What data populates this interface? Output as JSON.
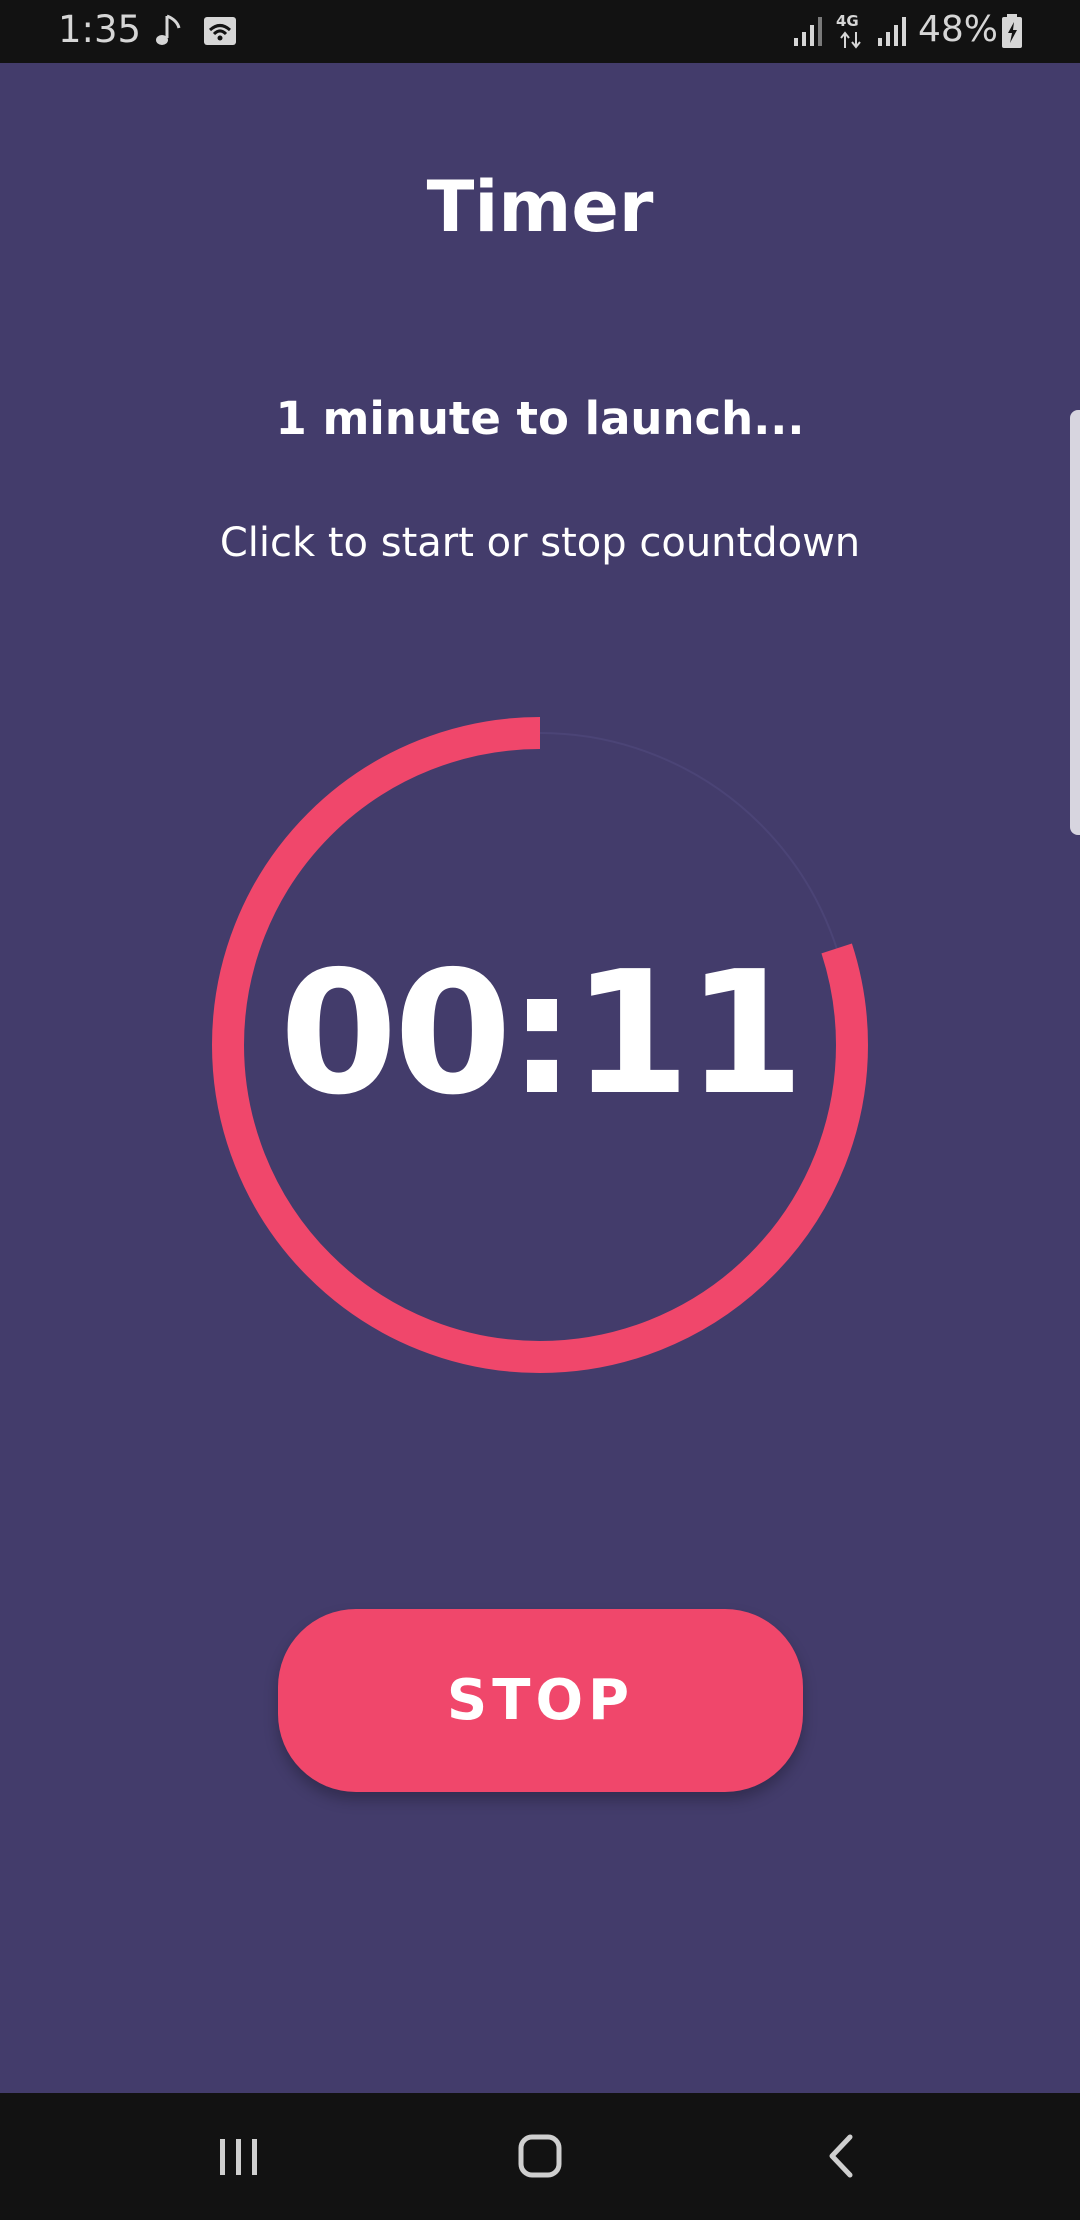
{
  "status_bar": {
    "time": "1:35",
    "battery_percent": "48%",
    "network_label": "4G",
    "icons": [
      "music-note-icon",
      "wifi-icon",
      "signal-icon",
      "signal-icon",
      "battery-charging-icon"
    ]
  },
  "page": {
    "title": "Timer",
    "subtitle": "1 minute to launch...",
    "hint": "Click to start or stop countdown"
  },
  "timer": {
    "readout": "00:11",
    "remaining_fraction": 0.8,
    "progress_color": "#f0476b",
    "track_color": "#4b4476"
  },
  "actions": {
    "stop_label": "STOP"
  },
  "nav_bar": {
    "icons": [
      "recents-icon",
      "home-icon",
      "back-icon"
    ]
  },
  "colors": {
    "background": "#433c6b",
    "accent": "#f0476b",
    "text": "#ffffff",
    "system_bar": "#121212"
  }
}
